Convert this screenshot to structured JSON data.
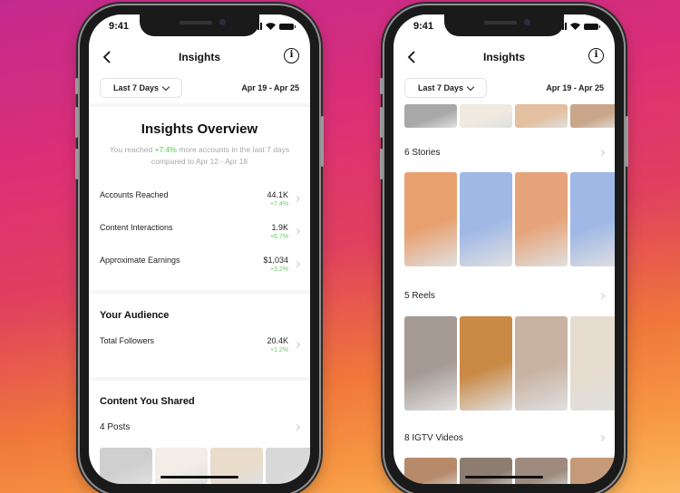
{
  "status_bar": {
    "time": "9:41"
  },
  "nav": {
    "title": "Insights",
    "back_icon": "chevron-left-icon",
    "info_icon": "info-icon"
  },
  "filter": {
    "range_label": "Last 7 Days",
    "date_range": "Apr 19 - Apr 25"
  },
  "overview": {
    "title": "Insights Overview",
    "subtitle_prefix": "You reached ",
    "subtitle_highlight": "+7.4%",
    "subtitle_suffix": " more accounts in the last 7 days compared to Apr 12 - Apr 18"
  },
  "metrics": [
    {
      "label": "Accounts Reached",
      "value": "44.1K",
      "delta": "+7.4%"
    },
    {
      "label": "Content Interactions",
      "value": "1.9K",
      "delta": "+6.7%"
    },
    {
      "label": "Approximate Earnings",
      "value": "$1,034",
      "delta": "+3.2%"
    }
  ],
  "audience": {
    "title": "Your Audience",
    "metrics": [
      {
        "label": "Total Followers",
        "value": "20.4K",
        "delta": "+1.2%"
      }
    ]
  },
  "content_shared": {
    "title": "Content You Shared",
    "groups": [
      {
        "label": "4 Posts",
        "thumb_colors": [
          "#cfcfcf",
          "#f2ede6",
          "#e9dccb",
          "#d8d8d8"
        ]
      },
      {
        "label": "6 Stories",
        "thumb_colors": [
          "#e8a070",
          "#9fb8e6",
          "#e6a47a",
          "#9fb8e6"
        ]
      },
      {
        "label": "5 Reels",
        "thumb_colors": [
          "#a59a94",
          "#c98a46",
          "#c8b3a3",
          "#e6dccf"
        ]
      },
      {
        "label": "8 IGTV Videos",
        "thumb_colors": [
          "#b88a6c",
          "#8d7c70",
          "#9e8b7e",
          "#c49a7a"
        ]
      }
    ]
  },
  "posts_top_strip_colors": [
    "#a8a8a8",
    "#efe9e0",
    "#e3c0a0",
    "#c9a68a"
  ],
  "colors": {
    "positive": "#5cc45c",
    "background_gradient": [
      "#c42a8e",
      "#dc2f76",
      "#f0783a",
      "#fbb860"
    ]
  }
}
